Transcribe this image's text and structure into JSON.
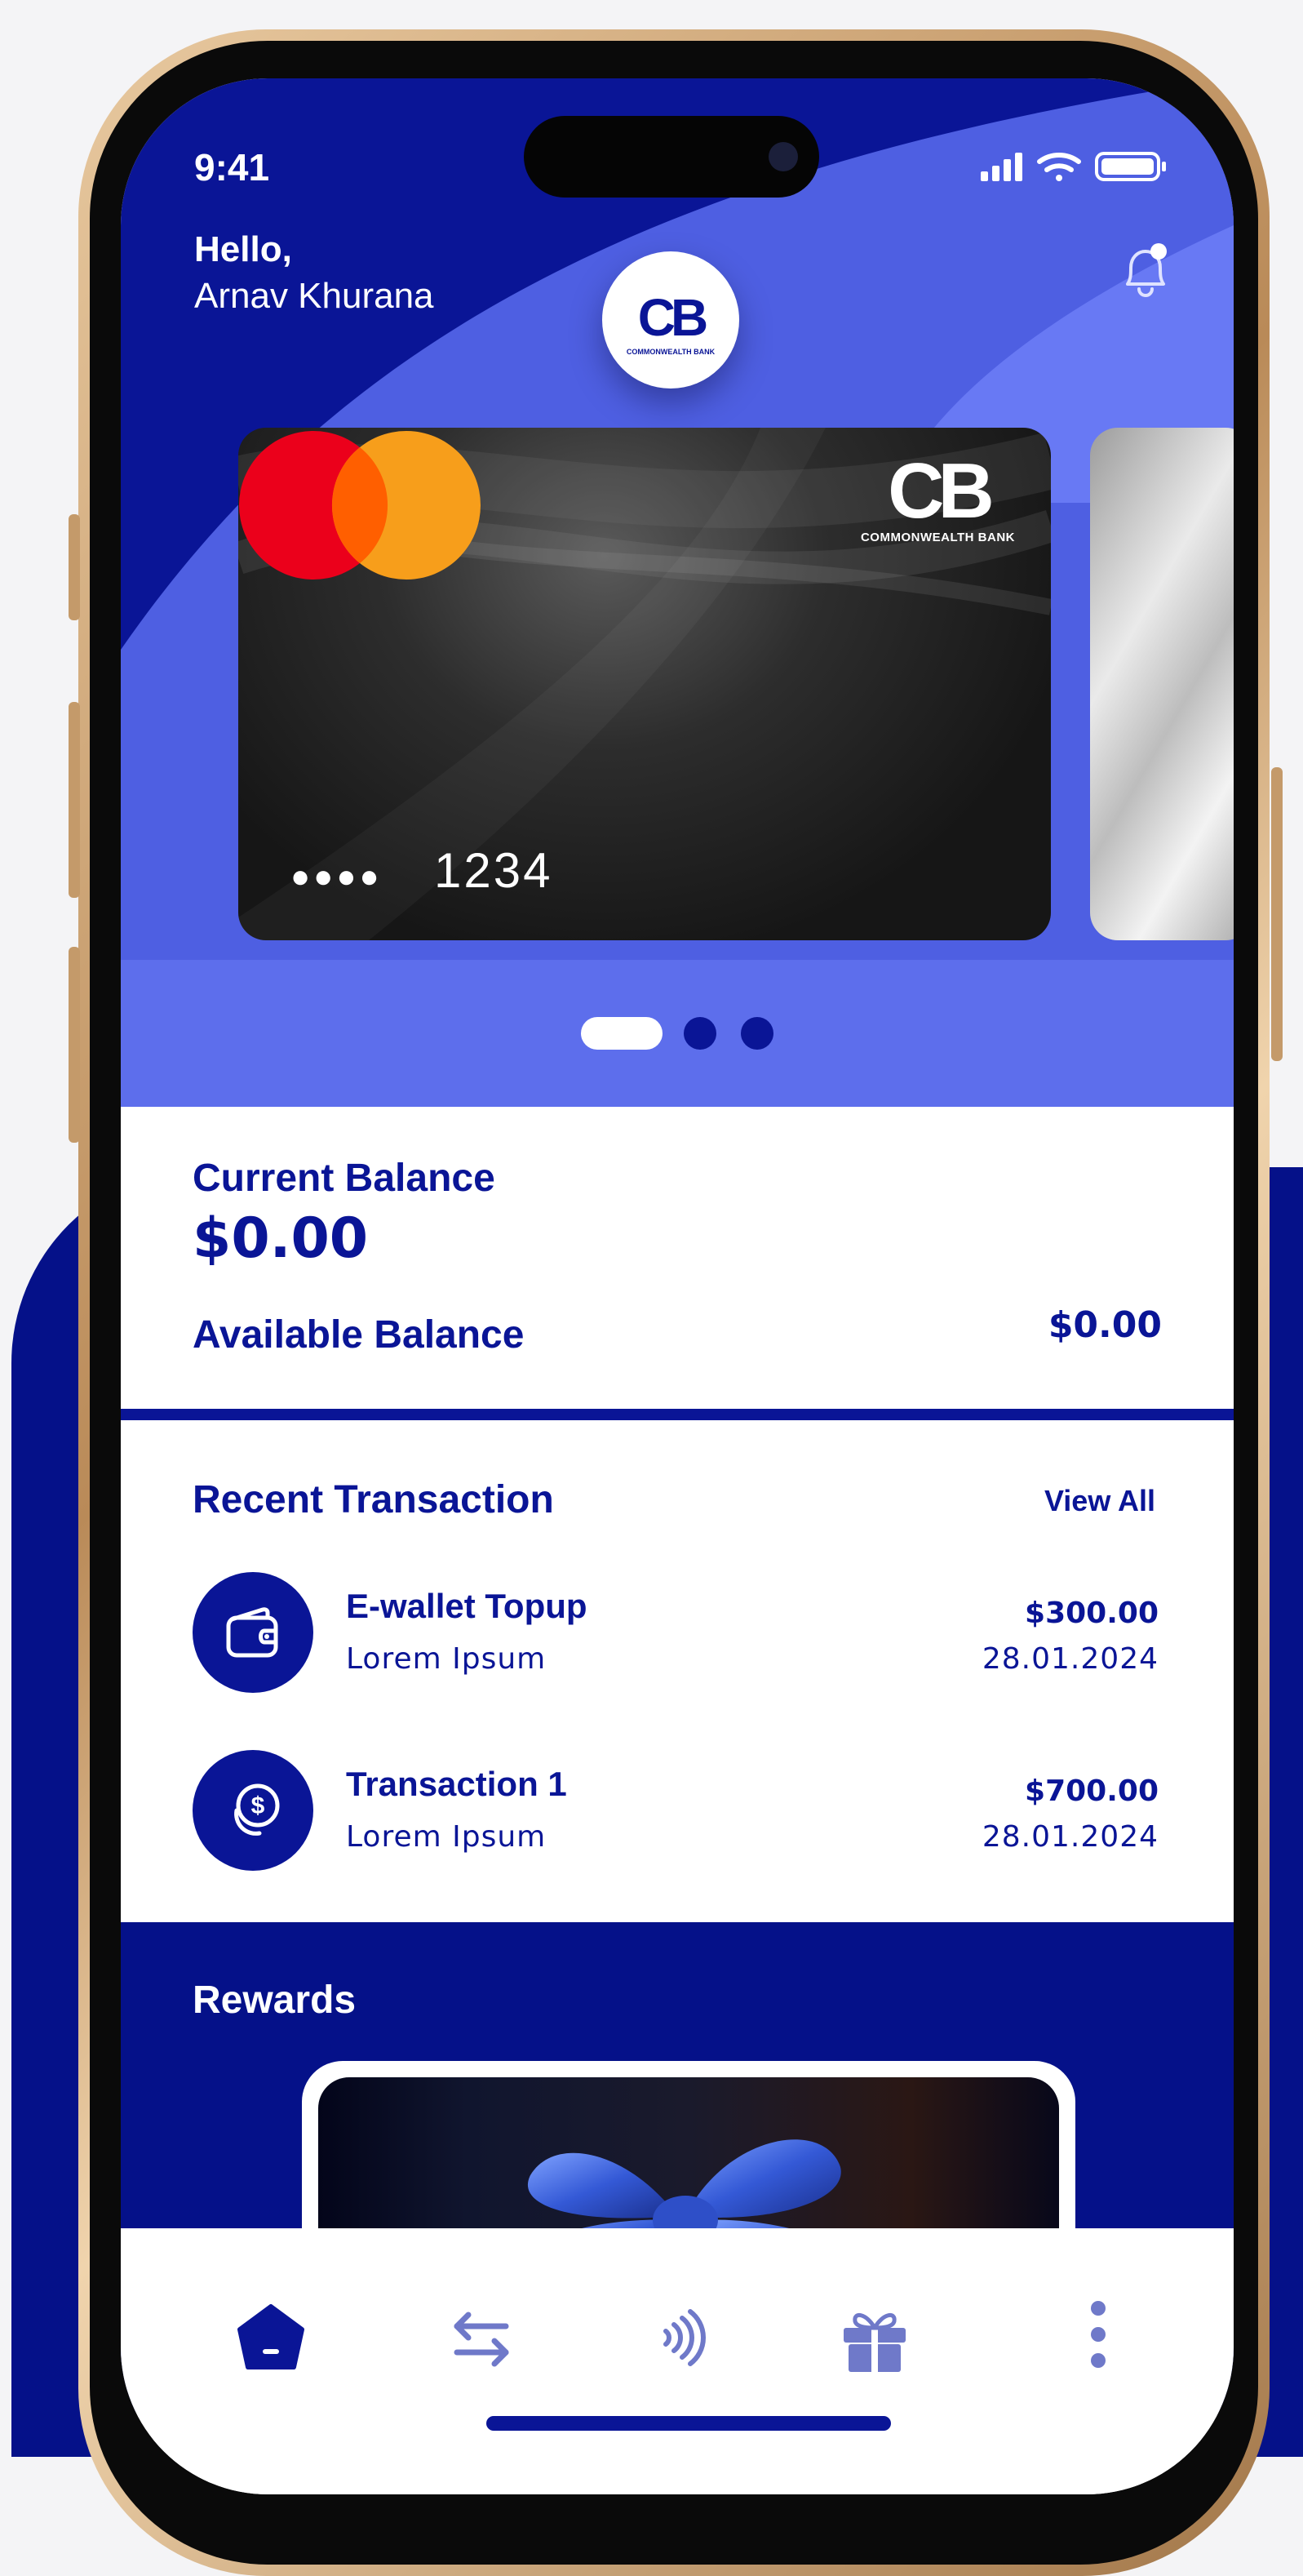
{
  "status_bar": {
    "time": "9:41"
  },
  "header": {
    "greeting": "Hello,",
    "user_name": "Arnav Khurana"
  },
  "brand": {
    "monogram": "CB",
    "name": "COMMONWEALTH BANK"
  },
  "card": {
    "masked_dots": "●●●●",
    "last4": "1234",
    "network": "mastercard"
  },
  "carousel": {
    "pages": 3,
    "active": 0
  },
  "balance": {
    "current_label": "Current Balance",
    "current_value": "$0.00",
    "available_label": "Available Balance",
    "available_value": "$0.00"
  },
  "recent": {
    "title": "Recent Transaction",
    "view_all": "View All",
    "items": [
      {
        "name": "E-wallet Topup",
        "sub": "Lorem Ipsum",
        "amount": "$300.00",
        "date": "28.01.2024",
        "icon": "wallet-icon"
      },
      {
        "name": "Transaction 1",
        "sub": "Lorem Ipsum",
        "amount": "$700.00",
        "date": "28.01.2024",
        "icon": "dollar-coins-icon"
      }
    ]
  },
  "rewards": {
    "title": "Rewards"
  },
  "nav": {
    "items": [
      {
        "icon": "home-icon",
        "active": true
      },
      {
        "icon": "transfer-icon",
        "active": false
      },
      {
        "icon": "contactless-icon",
        "active": false
      },
      {
        "icon": "gift-icon",
        "active": false
      },
      {
        "icon": "more-icon",
        "active": false
      }
    ]
  },
  "colors": {
    "primary": "#0a1596",
    "accent": "#5566e8",
    "card": "#1e1e1e",
    "mc_red": "#eb001b",
    "mc_orange": "#f79e1b",
    "nav_inactive": "#6f79c9"
  }
}
